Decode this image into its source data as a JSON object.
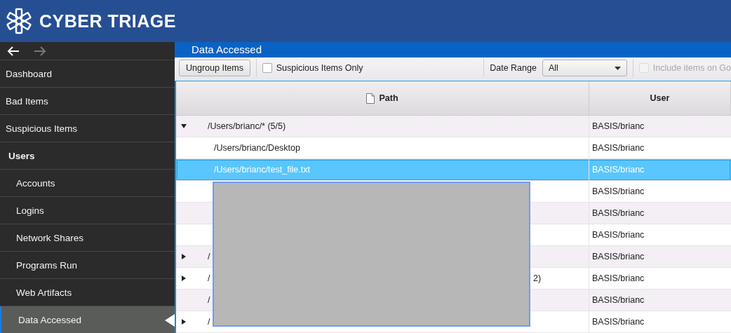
{
  "app": {
    "title": "CYBER TRIAGE"
  },
  "nav": {
    "back_enabled": true,
    "forward_enabled": false
  },
  "sidebar": {
    "items": [
      {
        "label": "Dashboard",
        "kind": "item",
        "selected": false
      },
      {
        "label": "Bad Items",
        "kind": "item",
        "selected": false
      },
      {
        "label": "Suspicious Items",
        "kind": "item",
        "selected": false
      },
      {
        "label": "Users",
        "kind": "section",
        "selected": false,
        "children": [
          {
            "label": "Accounts",
            "kind": "item",
            "selected": false
          },
          {
            "label": "Logins",
            "kind": "item",
            "selected": false
          },
          {
            "label": "Network Shares",
            "kind": "item",
            "selected": false
          },
          {
            "label": "Programs Run",
            "kind": "item",
            "selected": false
          },
          {
            "label": "Web Artifacts",
            "kind": "item",
            "selected": false
          },
          {
            "label": "Data Accessed",
            "kind": "item",
            "selected": true
          }
        ]
      }
    ]
  },
  "panel": {
    "title": "Data Accessed"
  },
  "toolbar": {
    "ungroup_button": "Ungroup Items",
    "suspicious_only": {
      "label": "Suspicious Items Only",
      "checked": false
    },
    "date_range": {
      "label": "Date Range",
      "value": "All"
    },
    "include_items": {
      "label": "Include items on Go",
      "checked": false,
      "disabled": true
    }
  },
  "table": {
    "columns": [
      "Path",
      "User"
    ],
    "rows": [
      {
        "kind": "group",
        "expanded": true,
        "path": "/Users/brianc/* (5/5)",
        "user": "BASIS/brianc",
        "selected": false,
        "children": [
          {
            "kind": "file",
            "path": "/Users/brianc/Desktop",
            "user": "BASIS/brianc",
            "selected": false
          },
          {
            "kind": "file",
            "path": "/Users/brianc/test_file.txt",
            "user": "BASIS/brianc",
            "selected": true
          },
          {
            "kind": "file",
            "user": "BASIS/brianc",
            "selected": false
          },
          {
            "kind": "file",
            "user": "BASIS/brianc",
            "selected": false
          },
          {
            "kind": "file",
            "user": "BASIS/brianc",
            "selected": false
          }
        ]
      },
      {
        "kind": "group",
        "expanded": false,
        "path": "/",
        "user": "BASIS/brianc",
        "selected": false
      },
      {
        "kind": "group",
        "expanded": false,
        "path": "/",
        "path_tail": "2)",
        "user": "BASIS/brianc",
        "selected": false
      },
      {
        "kind": "file",
        "path": "/",
        "user": "BASIS/brianc",
        "selected": false
      },
      {
        "kind": "group",
        "expanded": false,
        "path": "/",
        "user": "BASIS/brianc",
        "selected": false
      }
    ]
  },
  "redaction": {
    "kind": "gray-box"
  }
}
